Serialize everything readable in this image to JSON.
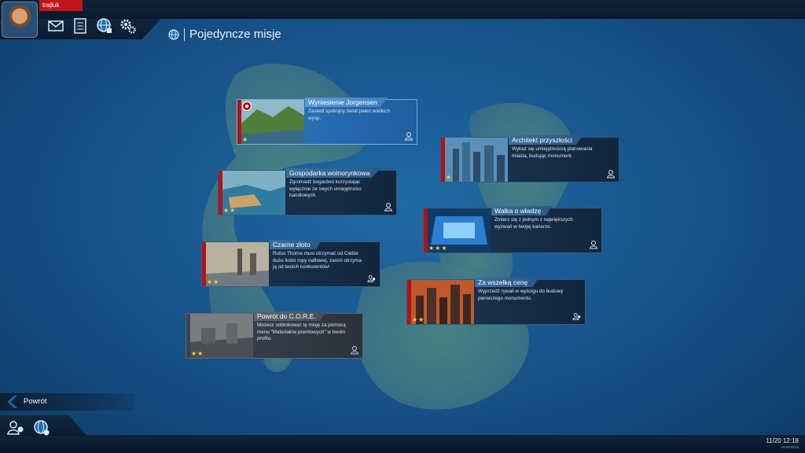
{
  "user": {
    "name": "trajluk"
  },
  "header": {
    "title": "Pojedyncze misje"
  },
  "missions": [
    {
      "name": "Wyniesienie Jorgensen",
      "desc": "Zasiedl spokojny świat pełen wielkich wysp.",
      "stars": "★"
    },
    {
      "name": "Architekt przyszłości",
      "desc": "Wykaż się umiejętnością planowania miasta, budując monument.",
      "stars": "★"
    },
    {
      "name": "Gospodarka wolnorynkowa",
      "desc": "Zgromadź bogactwo korzystając wyłącznie ze swych umiejętności handlowych.",
      "stars": "★★"
    },
    {
      "name": "Walka o władzę",
      "desc": "Zmierz się z jednym z największych wyzwań w twojej karierze.",
      "stars": "★★★"
    },
    {
      "name": "Czarne złoto",
      "desc": "Rufus Thorne musi otrzymać od Ciebie duże ilości ropy naftowej, zanim otrzyma ją od twoich konkurentów!",
      "stars": "★★"
    },
    {
      "name": "Za wszelką cenę",
      "desc": "Wyprzedź rywali w wyścigu do budowy pierwszego monumentu.",
      "stars": "★★"
    },
    {
      "name": "Powrót do C.O.R.E.",
      "desc": "Możesz odblokować tę misję za pomocą menu \"Materiałów premiowych\" w twoim profilu.",
      "stars": "★★"
    }
  ],
  "footer": {
    "back_label": "Powrót",
    "clock": "11/20 12:18",
    "version": "v0.00.6215"
  },
  "colors": {
    "accent_red": "#b31217",
    "accent_blue": "#2f7ac0",
    "star": "#f4d03f"
  }
}
